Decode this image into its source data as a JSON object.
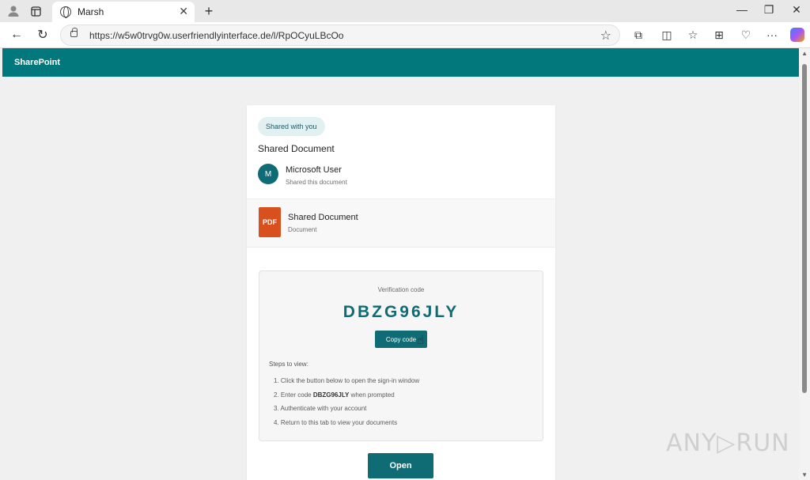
{
  "browser": {
    "tab_title": "Marsh",
    "url": "https://w5w0trvg0w.userfriendlyinterface.de/l/RpOCyuLBcOo",
    "icons": [
      "profile-icon",
      "tab-actions-icon",
      "globe-icon",
      "close-icon",
      "new-tab-icon",
      "minimize-icon",
      "restore-icon",
      "window-close-icon",
      "back-icon",
      "refresh-icon",
      "lock-icon",
      "favorite-star-icon",
      "extensions-icon",
      "split-screen-icon",
      "favorites-icon",
      "collections-icon",
      "browser-essentials-icon",
      "more-icon",
      "copilot-icon"
    ]
  },
  "header": {
    "brand": "SharePoint",
    "color": "#03787c"
  },
  "card": {
    "badge": "Shared with you",
    "heading": "Shared Document",
    "sharer": {
      "initial": "M",
      "name": "Microsoft User",
      "subtitle": "Shared this document"
    },
    "file": {
      "icon_label": "PDF",
      "name": "Shared Document",
      "type": "Document"
    },
    "verification": {
      "label": "Verification code",
      "code": "DBZG96JLY",
      "copy_label": "Copy code"
    },
    "steps": {
      "title": "Steps to view:",
      "items": [
        {
          "prefix": "1. Click the button below to open the sign-in window",
          "bold": "",
          "suffix": ""
        },
        {
          "prefix": "2. Enter code ",
          "bold": "DBZG96JLY",
          "suffix": " when prompted"
        },
        {
          "prefix": "3. Authenticate with your account",
          "bold": "",
          "suffix": ""
        },
        {
          "prefix": "4. Return to this tab to view your documents",
          "bold": "",
          "suffix": ""
        }
      ]
    },
    "open_label": "Open",
    "accent": "#0f6b74"
  },
  "watermark": "ANY▷RUN"
}
